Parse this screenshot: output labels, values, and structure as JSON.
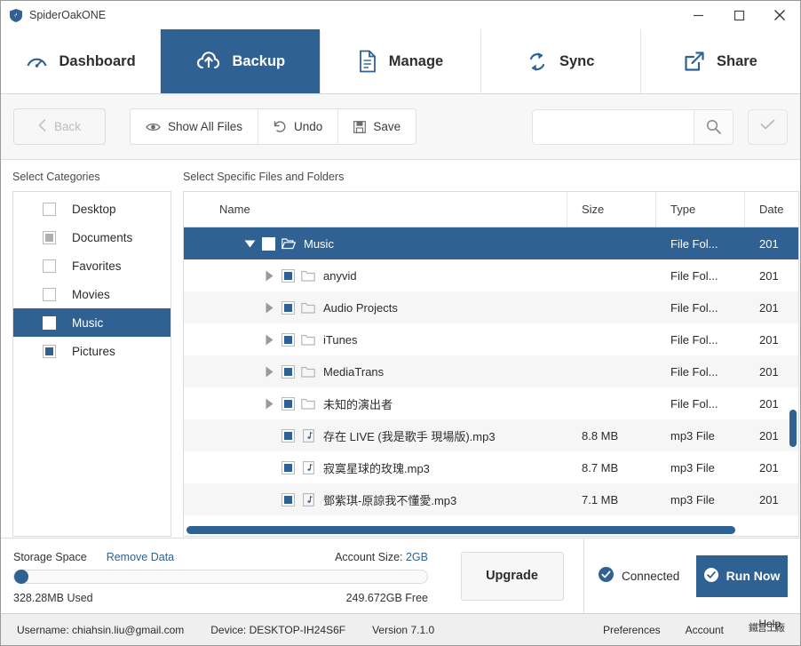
{
  "window": {
    "title": "SpiderOakONE",
    "logo_icon": "shield-icon",
    "minimize_icon": "minimize-icon",
    "maximize_icon": "maximize-icon",
    "close_icon": "close-icon"
  },
  "tabs": [
    {
      "label": "Dashboard",
      "icon": "gauge-icon",
      "active": false
    },
    {
      "label": "Backup",
      "icon": "cloud-upload-icon",
      "active": true
    },
    {
      "label": "Manage",
      "icon": "document-icon",
      "active": false
    },
    {
      "label": "Sync",
      "icon": "sync-arrows-icon",
      "active": false
    },
    {
      "label": "Share",
      "icon": "external-link-icon",
      "active": false
    }
  ],
  "toolbar": {
    "back_label": "Back",
    "back_icon": "chevron-left-icon",
    "back_disabled": true,
    "show_all_files_label": "Show All Files",
    "show_all_files_icon": "eye-icon",
    "undo_label": "Undo",
    "undo_icon": "undo-arrow-icon",
    "save_label": "Save",
    "save_icon": "floppy-disk-icon",
    "search_value": "",
    "search_placeholder": "",
    "search_icon": "search-icon",
    "confirm_icon": "check-icon"
  },
  "categories": {
    "label": "Select Categories",
    "items": [
      {
        "label": "Desktop",
        "check": "empty",
        "selected": false
      },
      {
        "label": "Documents",
        "check": "partial",
        "selected": false
      },
      {
        "label": "Favorites",
        "check": "empty",
        "selected": false
      },
      {
        "label": "Movies",
        "check": "empty",
        "selected": false
      },
      {
        "label": "Music",
        "check": "empty",
        "selected": true
      },
      {
        "label": "Pictures",
        "check": "full",
        "selected": false
      }
    ]
  },
  "files": {
    "label": "Select Specific Files and Folders",
    "columns": [
      "Name",
      "Size",
      "Type",
      "Date"
    ],
    "rows": [
      {
        "name": "Music",
        "size": "",
        "type": "File Fol...",
        "date": "201",
        "icon": "folder-open-icon",
        "check": "empty",
        "twisty": "down",
        "depth": 0,
        "selected": true
      },
      {
        "name": "anyvid",
        "size": "",
        "type": "File Fol...",
        "date": "201",
        "icon": "folder-icon",
        "check": "full",
        "twisty": "right",
        "depth": 1,
        "selected": false
      },
      {
        "name": "Audio Projects",
        "size": "",
        "type": "File Fol...",
        "date": "201",
        "icon": "folder-icon",
        "check": "full",
        "twisty": "right",
        "depth": 1,
        "selected": false
      },
      {
        "name": "iTunes",
        "size": "",
        "type": "File Fol...",
        "date": "201",
        "icon": "folder-icon",
        "check": "full",
        "twisty": "right",
        "depth": 1,
        "selected": false
      },
      {
        "name": "MediaTrans",
        "size": "",
        "type": "File Fol...",
        "date": "201",
        "icon": "folder-icon",
        "check": "full",
        "twisty": "right",
        "depth": 1,
        "selected": false
      },
      {
        "name": "未知的演出者",
        "size": "",
        "type": "File Fol...",
        "date": "201",
        "icon": "folder-icon",
        "check": "full",
        "twisty": "right",
        "depth": 1,
        "selected": false
      },
      {
        "name": "存在 LIVE (我是歌手 現場版).mp3",
        "size": "8.8 MB",
        "type": "mp3 File",
        "date": "201",
        "icon": "music-file-icon",
        "check": "full",
        "twisty": "none",
        "depth": 1,
        "selected": false
      },
      {
        "name": "寂寞星球的玫瑰.mp3",
        "size": "8.7 MB",
        "type": "mp3 File",
        "date": "201",
        "icon": "music-file-icon",
        "check": "full",
        "twisty": "none",
        "depth": 1,
        "selected": false
      },
      {
        "name": "鄧紫琪-原諒我不懂愛.mp3",
        "size": "7.1 MB",
        "type": "mp3 File",
        "date": "201",
        "icon": "music-file-icon",
        "check": "full",
        "twisty": "none",
        "depth": 1,
        "selected": false
      }
    ]
  },
  "status": {
    "storage_label": "Storage Space",
    "remove_data_label": "Remove Data",
    "account_size_prefix": "Account Size: ",
    "account_size_value": "2GB",
    "used_label": "328.28MB Used",
    "free_label": "249.672GB Free",
    "upgrade_label": "Upgrade",
    "connected_label": "Connected",
    "connected_icon": "check-circle-icon",
    "run_now_label": "Run Now",
    "run_now_icon": "check-circle-icon"
  },
  "footer": {
    "username": "Username: chiahsin.liu@gmail.com",
    "device": "Device: DESKTOP-IH24S6F",
    "version": "Version 7.1.0",
    "preferences_label": "Preferences",
    "account_label": "Account",
    "help_label": "Help",
    "watermark": "鐵言工廠"
  },
  "colors": {
    "accent": "#2f6293",
    "header_bg": "#f7f7f7",
    "footer_bg": "#efefef"
  }
}
